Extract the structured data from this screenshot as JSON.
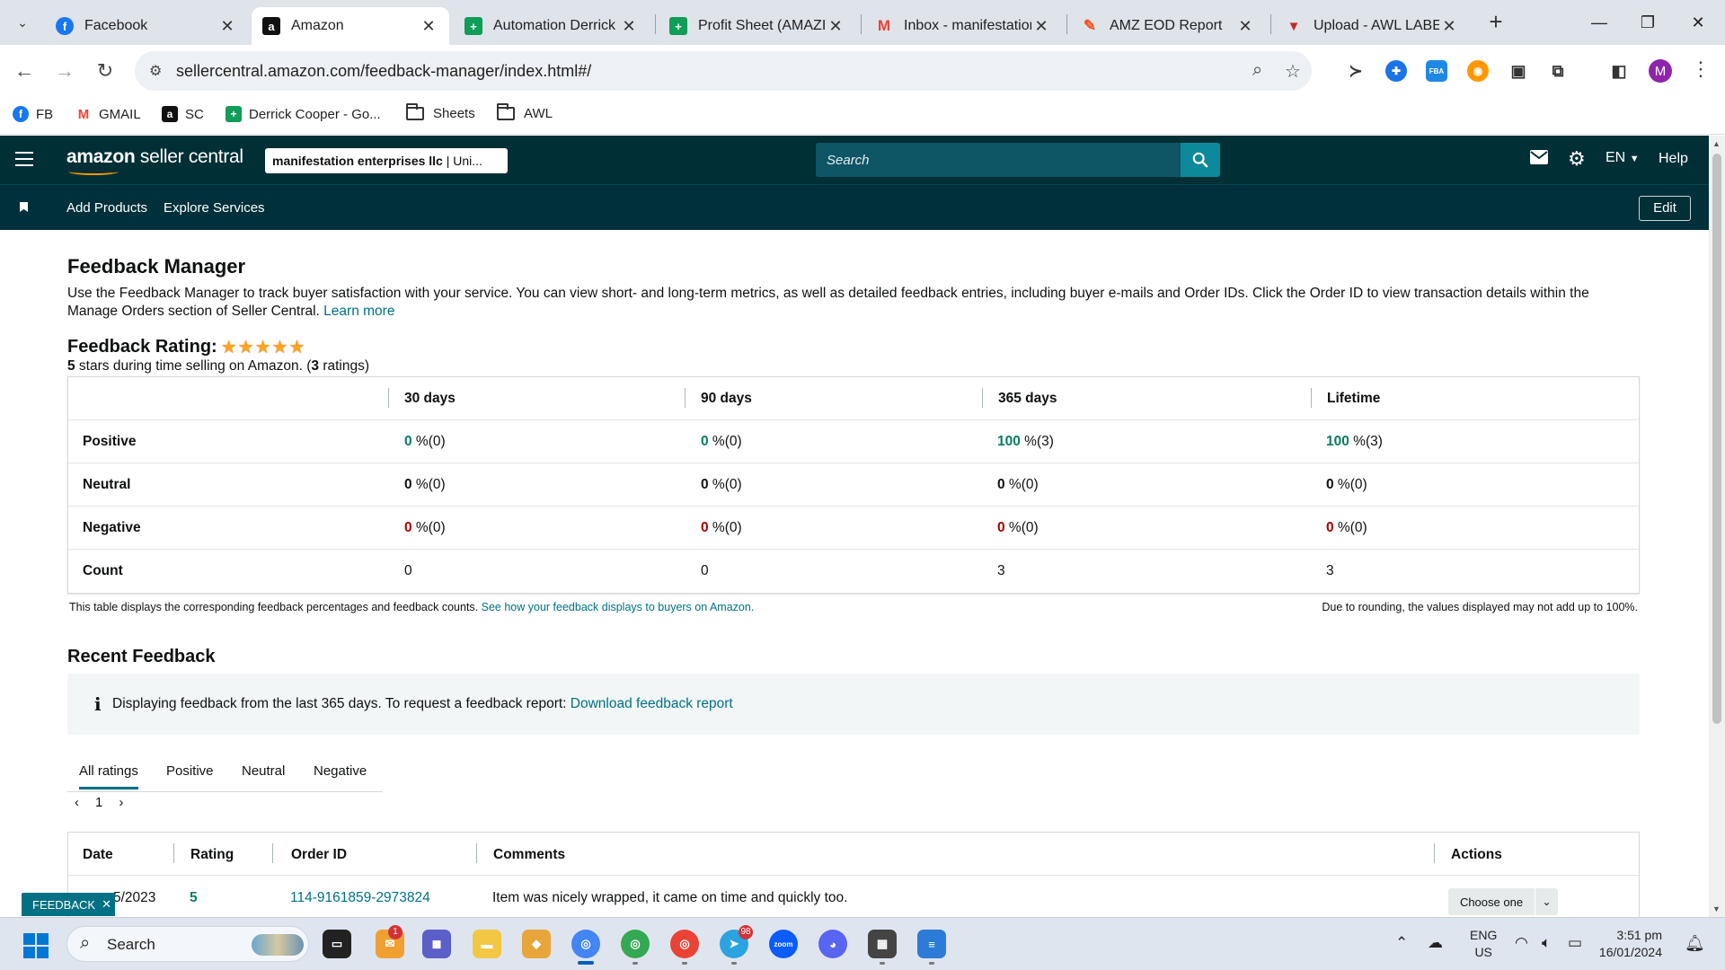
{
  "browser": {
    "tabs": [
      {
        "title": "Facebook",
        "icon": "facebook-icon",
        "color": "#1877f2",
        "glyph": "f"
      },
      {
        "title": "Amazon",
        "icon": "amazon-icon",
        "color": "#111111",
        "glyph": "a"
      },
      {
        "title": "Automation Derrick C",
        "icon": "sheets-icon",
        "color": "#0f9d58",
        "glyph": "+"
      },
      {
        "title": "Profit Sheet (AMAZIN",
        "icon": "sheets-icon",
        "color": "#0f9d58",
        "glyph": "+"
      },
      {
        "title": "Inbox - manifestation",
        "icon": "gmail-icon",
        "color": "#ea4335",
        "glyph": "M"
      },
      {
        "title": "AMZ EOD Report",
        "icon": "pencil-icon",
        "color": "#f4511e",
        "glyph": "✎"
      },
      {
        "title": "Upload - AWL LABEL",
        "icon": "awl-icon",
        "color": "#c62828",
        "glyph": "▼"
      }
    ],
    "url": "sellercentral.amazon.com/feedback-manager/index.html#/",
    "bookmarks": [
      {
        "label": "FB",
        "icon": "facebook-icon"
      },
      {
        "label": "GMAIL",
        "icon": "gmail-icon"
      },
      {
        "label": "SC",
        "icon": "amazon-icon"
      },
      {
        "label": "Derrick Cooper - Go...",
        "icon": "sheets-icon"
      },
      {
        "label": "Sheets",
        "icon": "folder-icon"
      },
      {
        "label": "AWL",
        "icon": "folder-icon"
      }
    ],
    "profile_initial": "M",
    "extensions": [
      {
        "name": "extension-1-icon",
        "glyph": "≻",
        "color": "#333333"
      },
      {
        "name": "extension-2-icon",
        "glyph": "✚",
        "color": "#1a73e8"
      },
      {
        "name": "fba-extension-icon",
        "glyph": "FBA",
        "color": "#1e88e5"
      },
      {
        "name": "extension-4-icon",
        "glyph": "◉",
        "color": "#ff9800"
      },
      {
        "name": "extension-5-icon",
        "glyph": "▣",
        "color": "#333333"
      }
    ]
  },
  "header": {
    "logo_bold": "amazon",
    "logo_rest": " seller central",
    "account_bold": "manifestation enterprises llc",
    "account_rest": " | Uni...",
    "search_placeholder": "Search",
    "lang": "EN",
    "help": "Help"
  },
  "subnav": {
    "links": [
      "Add Products",
      "Explore Services"
    ],
    "edit": "Edit"
  },
  "page": {
    "title": "Feedback Manager",
    "intro": "Use the Feedback Manager to track buyer satisfaction with your service. You can view short- and long-term metrics, as well as detailed feedback entries, including buyer e-mails and Order IDs. Click the Order ID to view transaction details within the Manage Orders section of Seller Central.",
    "learn_more": "Learn more",
    "rating_label": "Feedback Rating:",
    "rating_stars": 5,
    "rating_sub_num": "5",
    "rating_sub_mid": " stars during time selling on Amazon. (",
    "rating_sub_count": "3",
    "rating_sub_end": " ratings)"
  },
  "metrics": {
    "columns": [
      "30 days",
      "90 days",
      "365 days",
      "Lifetime"
    ],
    "rows": [
      {
        "label": "Positive",
        "kind": "pos",
        "values": [
          [
            "0",
            " %(0)"
          ],
          [
            "0",
            " %(0)"
          ],
          [
            "100",
            " %(3)"
          ],
          [
            "100",
            " %(3)"
          ]
        ]
      },
      {
        "label": "Neutral",
        "kind": "neu",
        "values": [
          [
            "0",
            " %(0)"
          ],
          [
            "0",
            " %(0)"
          ],
          [
            "0",
            " %(0)"
          ],
          [
            "0",
            " %(0)"
          ]
        ]
      },
      {
        "label": "Negative",
        "kind": "neg",
        "values": [
          [
            "0",
            " %(0)"
          ],
          [
            "0",
            " %(0)"
          ],
          [
            "0",
            " %(0)"
          ],
          [
            "0",
            " %(0)"
          ]
        ]
      },
      {
        "label": "Count",
        "kind": "plain",
        "values": [
          [
            "",
            "0"
          ],
          [
            "",
            "0"
          ],
          [
            "",
            "3"
          ],
          [
            "",
            "3"
          ]
        ]
      }
    ],
    "note": "This table displays the corresponding feedback percentages and feedback counts.",
    "note_link": "See how your feedback displays to buyers on Amazon.",
    "rounding_note": "Due to rounding, the values displayed may not add up to 100%."
  },
  "recent": {
    "title": "Recent Feedback",
    "info": "Displaying feedback from the last 365 days. To request a feedback report:",
    "info_link": "Download feedback report",
    "tabs": [
      "All ratings",
      "Positive",
      "Neutral",
      "Negative"
    ],
    "active_tab": "All ratings",
    "page": "1",
    "columns": [
      "Date",
      "Rating",
      "Order ID",
      "Comments",
      "Actions"
    ],
    "rows": [
      {
        "date": "5/2023",
        "rating": "5",
        "order_id": "114-9161859-2973824",
        "comment": "Item was nicely wrapped, it came on time and quickly too.",
        "action": "Choose one"
      }
    ]
  },
  "feedback_tab": "FEEDBACK",
  "taskbar": {
    "search": "Search",
    "lang_top": "ENG",
    "lang_bottom": "US",
    "time": "3:51 pm",
    "date": "16/01/2024",
    "badges": {
      "mail": "1",
      "telegram": "98"
    }
  }
}
